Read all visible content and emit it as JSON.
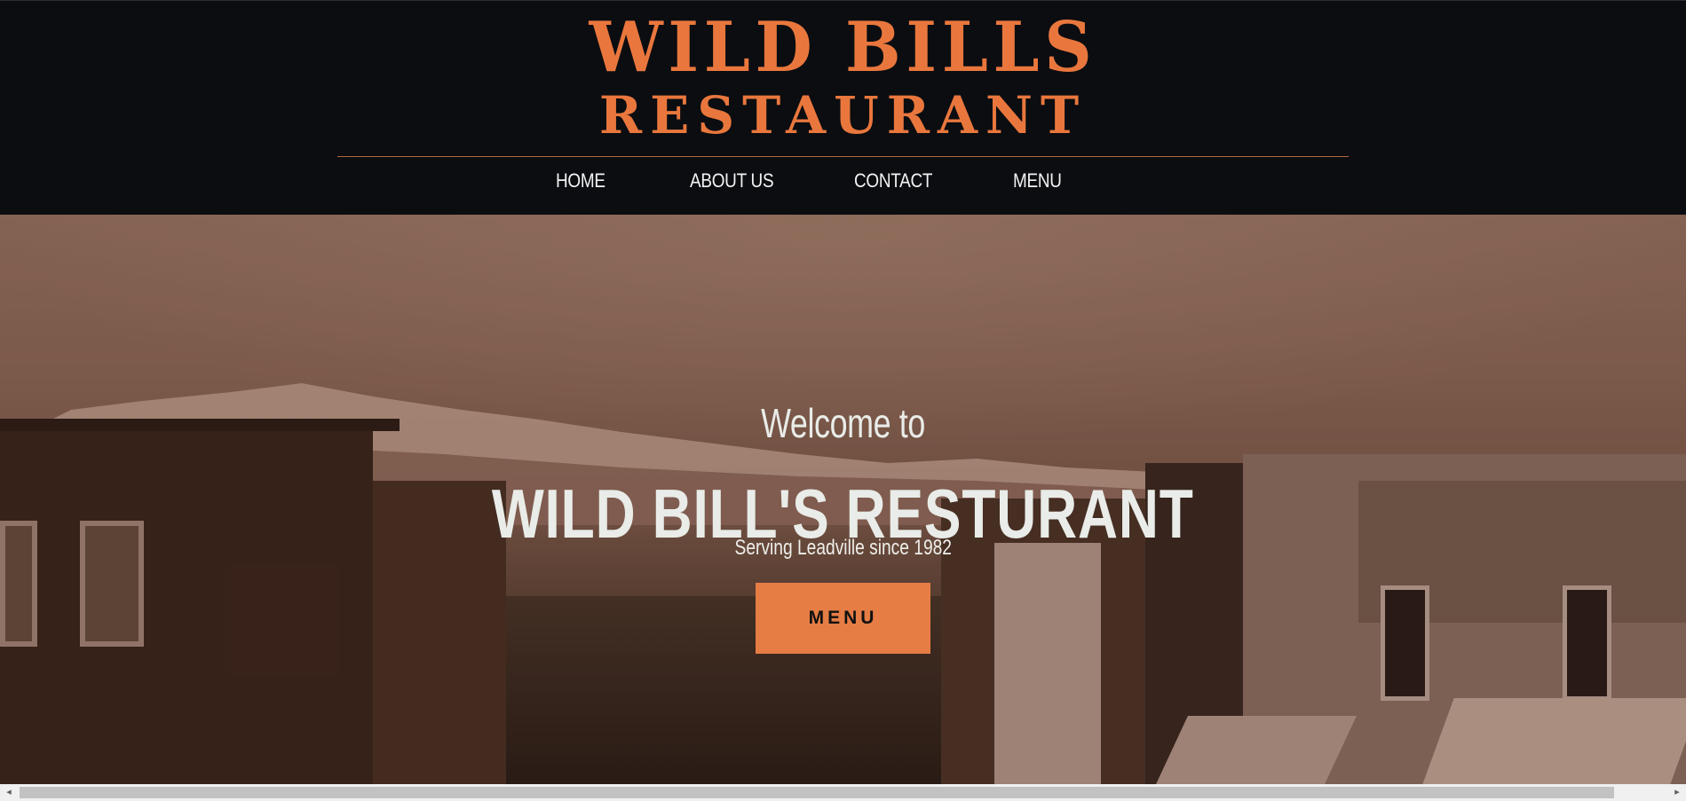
{
  "header": {
    "logo_line1": "WILD BILLS",
    "logo_line2": "RESTAURANT",
    "nav": [
      "HOME",
      "ABOUT US",
      "CONTACT",
      "MENU"
    ]
  },
  "hero": {
    "welcome": "Welcome to",
    "title": "WILD BILL'S RESTURANT",
    "tagline": "Serving Leadville since 1982",
    "button_label": "MENU"
  },
  "scrollbar": {
    "left_arrow": "◂",
    "right_arrow": "▸"
  },
  "colors": {
    "accent": "#e9773d",
    "header_bg": "#0b0d11",
    "button_bg": "#e57d45",
    "hero_text": "#e9ece8"
  }
}
